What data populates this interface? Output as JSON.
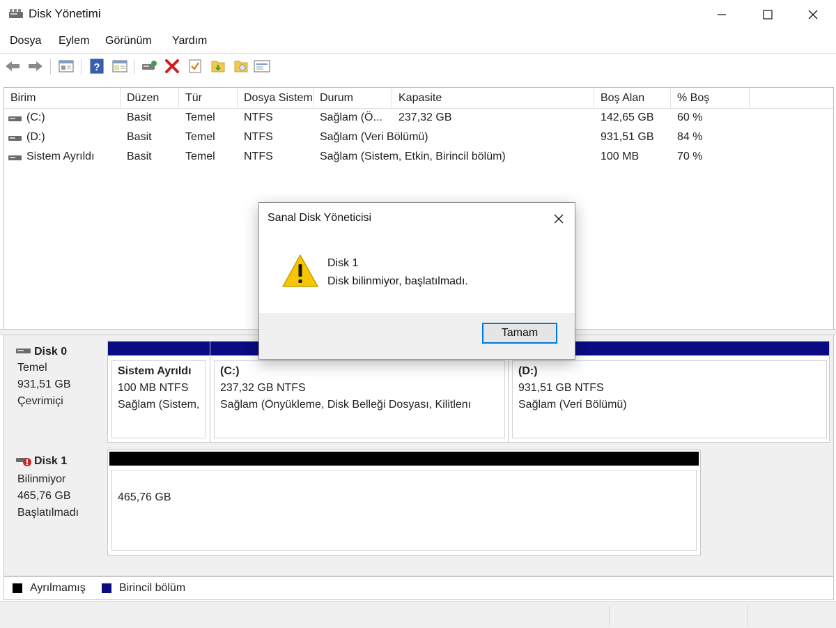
{
  "window": {
    "title": "Disk Yönetimi"
  },
  "menu": [
    "Dosya",
    "Eylem",
    "Görünüm",
    "Yardım"
  ],
  "toolbar": {
    "icons": [
      "back-arrow-icon",
      "forward-arrow-icon",
      "properties-icon",
      "help-icon",
      "console-tree-icon",
      "connect-disk-icon",
      "delete-icon",
      "checklist-icon",
      "import-icon",
      "export-icon",
      "properties-list-icon"
    ]
  },
  "volume_list": {
    "columns": [
      "Birim",
      "Düzen",
      "Tür",
      "Dosya Sistemi",
      "Durum",
      "Kapasite",
      "Boş Alan",
      "% Boş"
    ],
    "rows": [
      {
        "birim": "(C:)",
        "duzen": "Basit",
        "tur": "Temel",
        "dosya_sistemi": "NTFS",
        "durum": "Sağlam (Ö...",
        "kapasite": "237,32 GB",
        "bos_alan": "142,65 GB",
        "yuzde_bos": "60 %"
      },
      {
        "birim": "(D:)",
        "duzen": "Basit",
        "tur": "Temel",
        "dosya_sistemi": "NTFS",
        "durum": "Sağlam (Veri Bölümü)",
        "kapasite": "",
        "bos_alan": "931,51 GB",
        "yuzde_bos": "84 %"
      },
      {
        "birim": "Sistem Ayrıldı",
        "duzen": "Basit",
        "tur": "Temel",
        "dosya_sistemi": "NTFS",
        "durum": "Sağlam (Sistem, Etkin, Birincil bölüm)",
        "kapasite": "",
        "bos_alan": "100 MB",
        "yuzde_bos": "70 %"
      }
    ]
  },
  "disks": [
    {
      "name": "Disk 0",
      "type": "Temel",
      "size": "931,51 GB",
      "status": "Çevrimiçi",
      "partitions": [
        {
          "title": "Sistem Ayrıldı",
          "fs": "100 MB NTFS",
          "status": "Sağlam (Sistem,",
          "bar_color": "#0a0a82"
        },
        {
          "title": "(C:)",
          "fs": "237,32 GB NTFS",
          "status": "Sağlam (Önyükleme, Disk Belleği Dosyası, Kilitlenı",
          "bar_color": "#0a0a82"
        },
        {
          "title": "(D:)",
          "fs": "931,51 GB NTFS",
          "status": "Sağlam (Veri Bölümü)",
          "bar_color": "#0a0a82"
        }
      ]
    },
    {
      "name": "Disk 1",
      "type": "Bilinmiyor",
      "size": "465,76 GB",
      "status": "Başlatılmadı",
      "partitions": [
        {
          "title": "",
          "fs": "465,76 GB",
          "status": "",
          "bar_color": "#000000"
        }
      ]
    }
  ],
  "legend": [
    {
      "label": "Ayrılmamış",
      "color": "#000000"
    },
    {
      "label": "Birincil bölüm",
      "color": "#0a0a82"
    }
  ],
  "dialog": {
    "title": "Sanal Disk Yöneticisi",
    "message_line1": "Disk 1",
    "message_line2": "Disk bilinmiyor, başlatılmadı.",
    "ok_label": "Tamam",
    "icon": "warning-icon"
  }
}
